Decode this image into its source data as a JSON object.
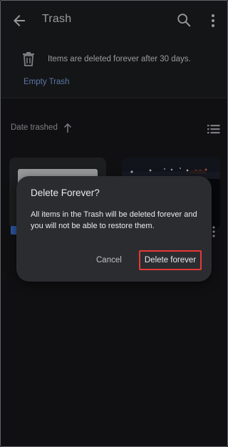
{
  "appbar": {
    "title": "Trash",
    "back_icon": "arrow-back-icon",
    "search_icon": "search-icon",
    "more_icon": "more-vert-icon"
  },
  "banner": {
    "info_text": "Items are deleted forever after 30 days.",
    "empty_trash_label": "Empty Trash",
    "icon": "trash-icon"
  },
  "sort": {
    "label": "Date trashed",
    "direction_icon": "arrow-up-icon",
    "view_icon": "list-view-icon"
  },
  "dialog": {
    "title": "Delete Forever?",
    "body": "All items in the Trash will be deleted forever and you will not be able to restore them.",
    "cancel_label": "Cancel",
    "delete_label": "Delete forever"
  },
  "colors": {
    "background": "#202124",
    "accent": "#8ab4f8",
    "highlight": "#e53935",
    "dialog": "#2b2c30"
  }
}
